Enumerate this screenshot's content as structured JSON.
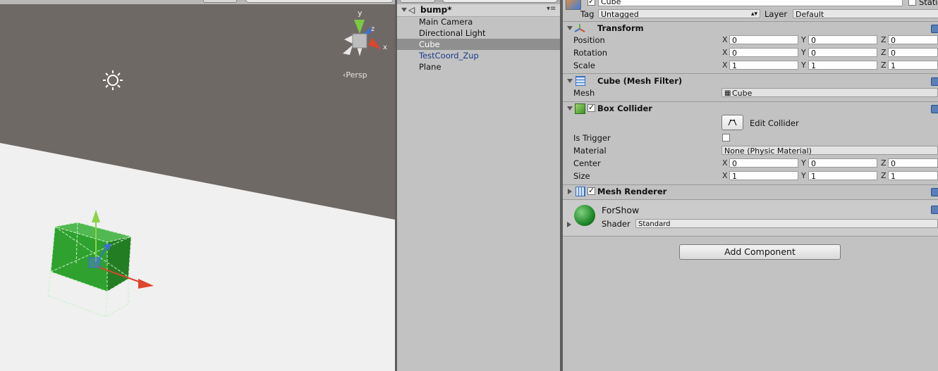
{
  "scene": {
    "projection_label": "‹Persp",
    "gizmo_axes": {
      "y": "y",
      "z": "z",
      "x": "x"
    }
  },
  "hierarchy": {
    "scene_name": "bump*",
    "items": [
      {
        "label": "Main Camera"
      },
      {
        "label": "Directional Light"
      },
      {
        "label": "Cube",
        "selected": true
      },
      {
        "label": "TestCoord_Zup",
        "prefab": true
      },
      {
        "label": "Plane"
      }
    ]
  },
  "inspector": {
    "object_name": "Cube",
    "static_label": "Stati",
    "tag_label": "Tag",
    "tag_value": "Untagged",
    "layer_label": "Layer",
    "layer_value": "Default",
    "transform": {
      "title": "Transform",
      "rows": [
        {
          "label": "Position",
          "x": "0",
          "y": "0",
          "z": "0"
        },
        {
          "label": "Rotation",
          "x": "0",
          "y": "0",
          "z": "0"
        },
        {
          "label": "Scale",
          "x": "1",
          "y": "1",
          "z": "1"
        }
      ]
    },
    "mesh_filter": {
      "title": "Cube (Mesh Filter)",
      "mesh_label": "Mesh",
      "mesh_value": "Cube"
    },
    "box_collider": {
      "title": "Box Collider",
      "edit_label": "Edit Collider",
      "is_trigger_label": "Is Trigger",
      "material_label": "Material",
      "material_value": "None (Physic Material)",
      "center": {
        "label": "Center",
        "x": "0",
        "y": "0",
        "z": "0"
      },
      "size": {
        "label": "Size",
        "x": "1",
        "y": "1",
        "z": "1"
      }
    },
    "mesh_renderer": {
      "title": "Mesh Renderer"
    },
    "material": {
      "name": "ForShow",
      "shader_label": "Shader",
      "shader_value": "Standard"
    },
    "add_component_label": "Add Component",
    "axis_labels": {
      "x": "X",
      "y": "Y",
      "z": "Z"
    }
  },
  "colors": {
    "sky": "#6f6966",
    "ground": "#f0f0f0",
    "selection": "#8f8f8f",
    "prefab_text": "#1d3b8a",
    "cube_green": "#2ea12e"
  }
}
